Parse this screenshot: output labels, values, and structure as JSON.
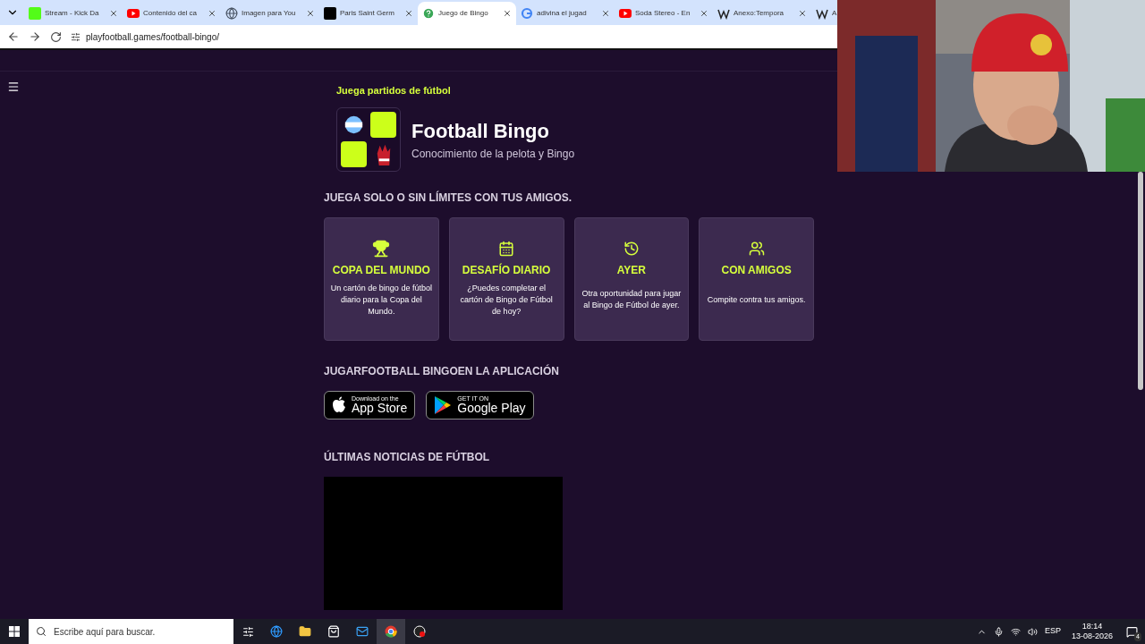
{
  "browser": {
    "tabs": [
      {
        "title": "Stream - Kick Da",
        "kind": "kick",
        "selected": false
      },
      {
        "title": "Contenido del ca",
        "kind": "youtube",
        "selected": false
      },
      {
        "title": "Imagen para You",
        "kind": "globe",
        "selected": false
      },
      {
        "title": "Paris Saint Germ",
        "kind": "np",
        "selected": false
      },
      {
        "title": "Juego de Bingo",
        "kind": "help",
        "selected": true
      },
      {
        "title": "adivina el jugad",
        "kind": "google",
        "selected": false
      },
      {
        "title": "Soda Stereo - En",
        "kind": "youtube",
        "selected": false
      },
      {
        "title": "Anexo:Tempora",
        "kind": "wiki",
        "selected": false
      },
      {
        "title": "A",
        "kind": "wiki",
        "selected": false
      }
    ],
    "url": "playfootball.games/football-bingo/"
  },
  "page": {
    "eyebrow": "Juega partidos de fútbol",
    "title": "Football Bingo",
    "subtitle": "Conocimiento de la pelota y Bingo",
    "modes_heading": "JUEGA SOLO O SIN LÍMITES CON TUS AMIGOS.",
    "modes": [
      {
        "kind": "trophy",
        "title": "COPA DEL MUNDO",
        "text": "Un cartón de bingo de fútbol diario para la Copa del Mundo."
      },
      {
        "kind": "calendar",
        "title": "DESAFÍO DIARIO",
        "text": "¿Puedes completar el cartón de Bingo de Fútbol de hoy?"
      },
      {
        "kind": "history",
        "title": "AYER",
        "text": "Otra oportunidad para jugar al Bingo de Fútbol de ayer."
      },
      {
        "kind": "users",
        "title": "CON AMIGOS",
        "text": "Compite contra tus amigos."
      }
    ],
    "app_heading": "JUGARFOOTBALL BINGOEN LA APLICACIÓN",
    "stores": [
      {
        "kind": "apple",
        "small": "Download on the",
        "big": "App Store"
      },
      {
        "kind": "google",
        "small": "GET IT ON",
        "big": "Google Play"
      }
    ],
    "news_heading": "ÚLTIMAS NOTICIAS DE FÚTBOL"
  },
  "taskbar": {
    "search_placeholder": "Escribe aquí para buscar.",
    "language": "ESP",
    "time": "18:14",
    "date": "13-08-2026",
    "notifications": "4"
  }
}
